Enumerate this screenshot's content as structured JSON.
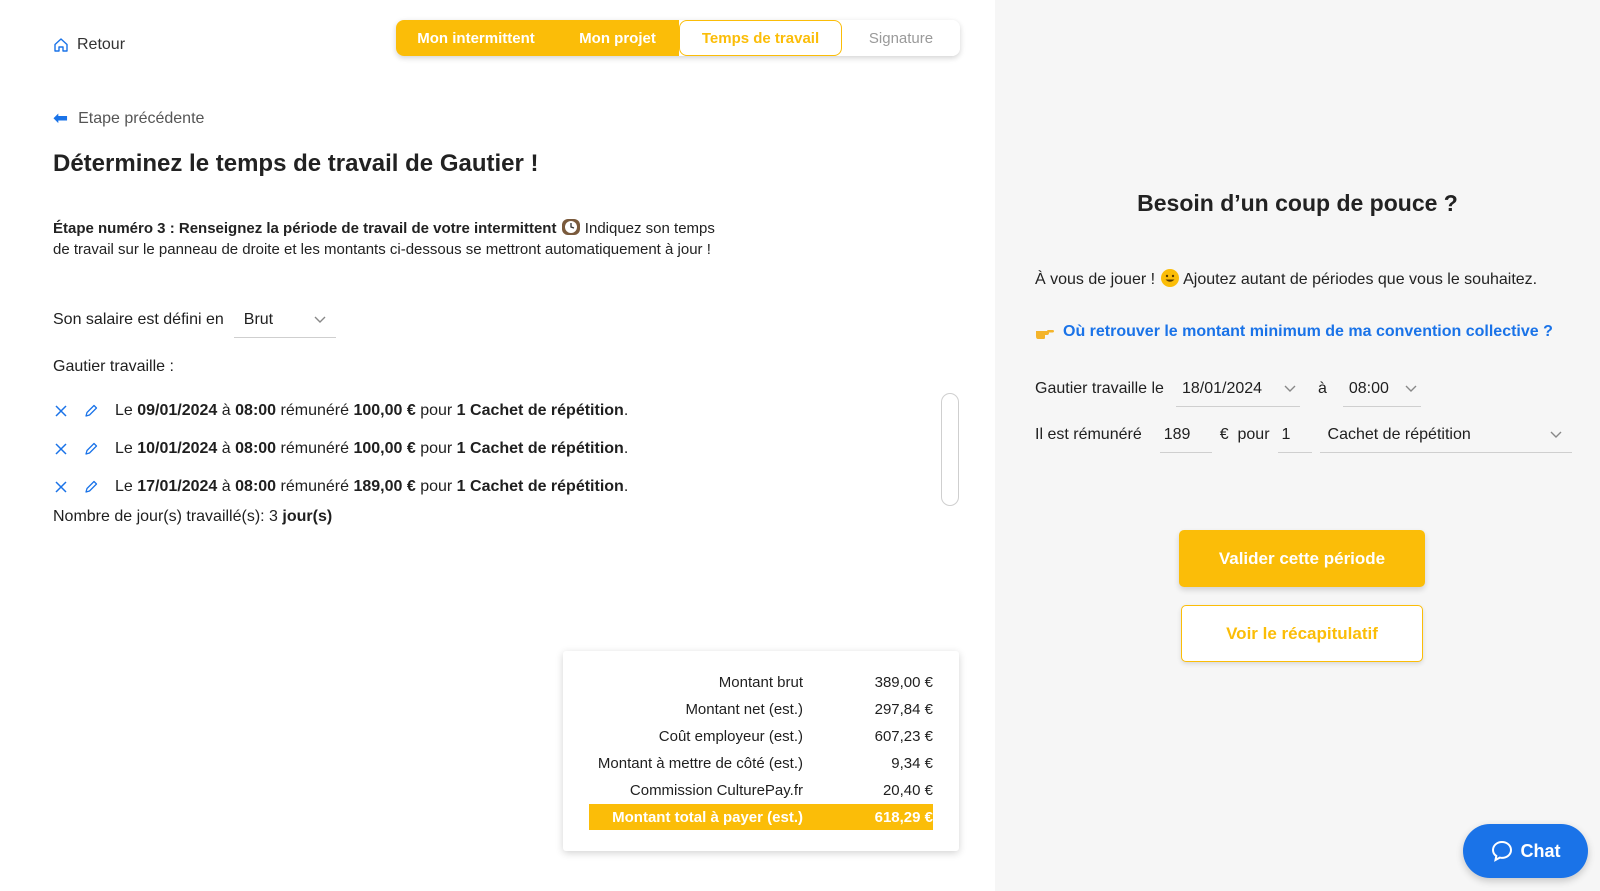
{
  "header": {
    "back_label": "Retour",
    "steps": [
      {
        "label": "Mon intermittent",
        "state": "done"
      },
      {
        "label": "Mon projet",
        "state": "done"
      },
      {
        "label": "Temps de travail",
        "state": "current"
      },
      {
        "label": "Signature",
        "state": "todo"
      }
    ]
  },
  "main": {
    "prev_step_label": "Etape précédente",
    "title": "Déterminez le temps de travail de Gautier !",
    "intro_bold": "Étape numéro 3 : Renseignez la période de travail de votre intermittent",
    "intro_rest": " Indiquez son temps de travail sur le panneau de droite et les montants ci-dessous se mettront automatiquement à jour !",
    "salary_label": "Son salaire est défini en",
    "salary_type": "Brut",
    "works_label": "Gautier travaille :",
    "periods": [
      {
        "prefix": "Le",
        "date": "09/01/2024",
        "a": "à",
        "time": "08:00",
        "paid": "rémunéré",
        "amount": "100,00 €",
        "for": "pour",
        "qty_type": "1 Cachet de répétition"
      },
      {
        "prefix": "Le",
        "date": "10/01/2024",
        "a": "à",
        "time": "08:00",
        "paid": "rémunéré",
        "amount": "100,00 €",
        "for": "pour",
        "qty_type": "1 Cachet de répétition"
      },
      {
        "prefix": "Le",
        "date": "17/01/2024",
        "a": "à",
        "time": "08:00",
        "paid": "rémunéré",
        "amount": "189,00 €",
        "for": "pour",
        "qty_type": "1 Cachet de répétition"
      }
    ],
    "days_label": "Nombre de jour(s) travaillé(s): 3",
    "days_unit": "jour(s)",
    "summary": [
      {
        "label": "Montant brut",
        "value": "389,00 €"
      },
      {
        "label": "Montant net (est.)",
        "value": "297,84 €"
      },
      {
        "label": "Coût employeur (est.)",
        "value": "607,23 €"
      },
      {
        "label": "Montant à mettre de côté (est.)",
        "value": "9,34 €"
      },
      {
        "label": "Commission CulturePay.fr",
        "value": "20,40 €"
      },
      {
        "label": "Montant total à payer (est.)",
        "value": "618,29 €"
      }
    ]
  },
  "help": {
    "title": "Besoin d’un coup de pouce ?",
    "text_a": "À vous de jouer !",
    "text_b": " Ajoutez autant de périodes que vous le souhaitez.",
    "link": "Où retrouver le montant minimum de ma convention collective ?",
    "form": {
      "works_on_label": "Gautier travaille le",
      "date": "18/01/2024",
      "at": "à",
      "time": "08:00",
      "paid_label": "Il est rémunéré",
      "amount": "189",
      "currency_for": "€  pour",
      "qty": "1",
      "type": "Cachet de répétition"
    },
    "validate_label": "Valider cette période",
    "summary_label": "Voir le récapitulatif"
  },
  "chat": {
    "label": "Chat"
  },
  "colors": {
    "accent": "#fbbd08",
    "link": "#1a73e8",
    "panel": "#f6f6f6"
  }
}
